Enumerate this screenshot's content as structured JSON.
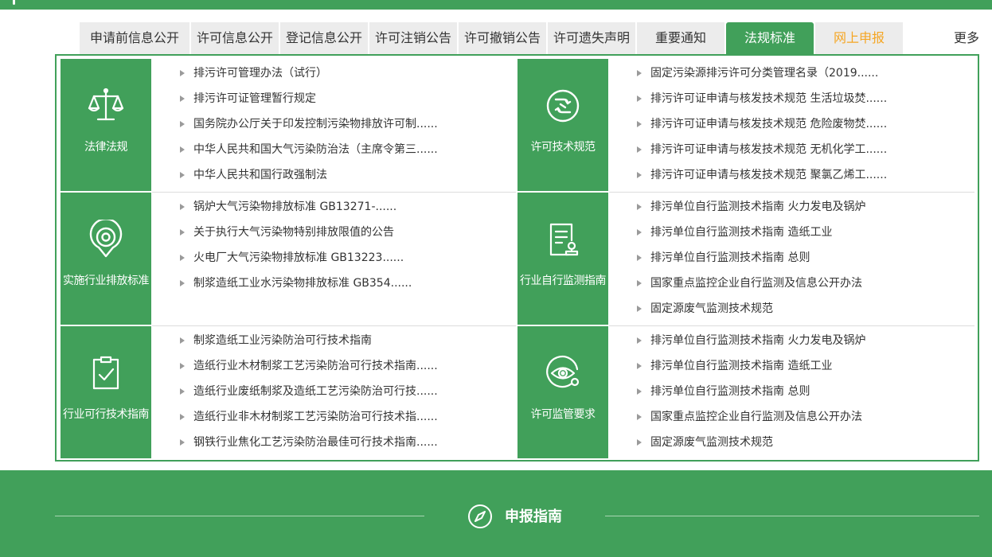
{
  "tabs": [
    {
      "label": "申请前信息公开"
    },
    {
      "label": "许可信息公开"
    },
    {
      "label": "登记信息公开"
    },
    {
      "label": "许可注销公告"
    },
    {
      "label": "许可撤销公告"
    },
    {
      "label": "许可遗失声明"
    },
    {
      "label": "重要通知"
    },
    {
      "label": "法规标准"
    },
    {
      "label": "网上申报"
    }
  ],
  "more_label": "更多",
  "sections": [
    {
      "title": "法律法规",
      "icon": "scales-icon",
      "items": [
        "排污许可管理办法（试行）",
        "排污许可证管理暂行规定",
        "国务院办公厅关于印发控制污染物排放许可制......",
        "中华人民共和国大气污染防治法（主席令第三......",
        "中华人民共和国行政强制法"
      ]
    },
    {
      "title": "许可技术规范",
      "icon": "recycle-icon",
      "items": [
        "固定污染源排污许可分类管理名录（2019......",
        "排污许可证申请与核发技术规范 生活垃圾焚......",
        "排污许可证申请与核发技术规范 危险废物焚......",
        "排污许可证申请与核发技术规范 无机化学工......",
        "排污许可证申请与核发技术规范 聚氯乙烯工......"
      ]
    },
    {
      "title": "实施行业排放标准",
      "icon": "location-pin-icon",
      "items": [
        "锅炉大气污染物排放标准 GB13271-......",
        "关于执行大气污染物特别排放限值的公告",
        "火电厂大气污染物排放标准 GB13223......",
        "制浆造纸工业水污染物排放标准 GB354......"
      ]
    },
    {
      "title": "行业自行监测指南",
      "icon": "document-stamp-icon",
      "items": [
        "排污单位自行监测技术指南 火力发电及锅炉",
        "排污单位自行监测技术指南 造纸工业",
        "排污单位自行监测技术指南 总则",
        "国家重点监控企业自行监测及信息公开办法",
        "固定源废气监测技术规范"
      ]
    },
    {
      "title": "行业可行技术指南",
      "icon": "clipboard-check-icon",
      "items": [
        "制浆造纸工业污染防治可行技术指南",
        "造纸行业木材制浆工艺污染防治可行技术指南......",
        "造纸行业废纸制浆及造纸工艺污染防治可行技......",
        "造纸行业非木材制浆工艺污染防治可行技术指......",
        "钢铁行业焦化工艺污染防治最佳可行技术指南......"
      ]
    },
    {
      "title": "许可监管要求",
      "icon": "eye-search-icon",
      "items": [
        "排污单位自行监测技术指南 火力发电及锅炉",
        "排污单位自行监测技术指南 造纸工业",
        "排污单位自行监测技术指南 总则",
        "国家重点监控企业自行监测及信息公开办法",
        "固定源废气监测技术规范"
      ]
    }
  ],
  "footer": {
    "title": "申报指南",
    "icon": "compass-icon"
  },
  "colors": {
    "brand_green": "#41a05a",
    "tab_gray": "#ececec",
    "accent_orange": "#f5a623"
  }
}
